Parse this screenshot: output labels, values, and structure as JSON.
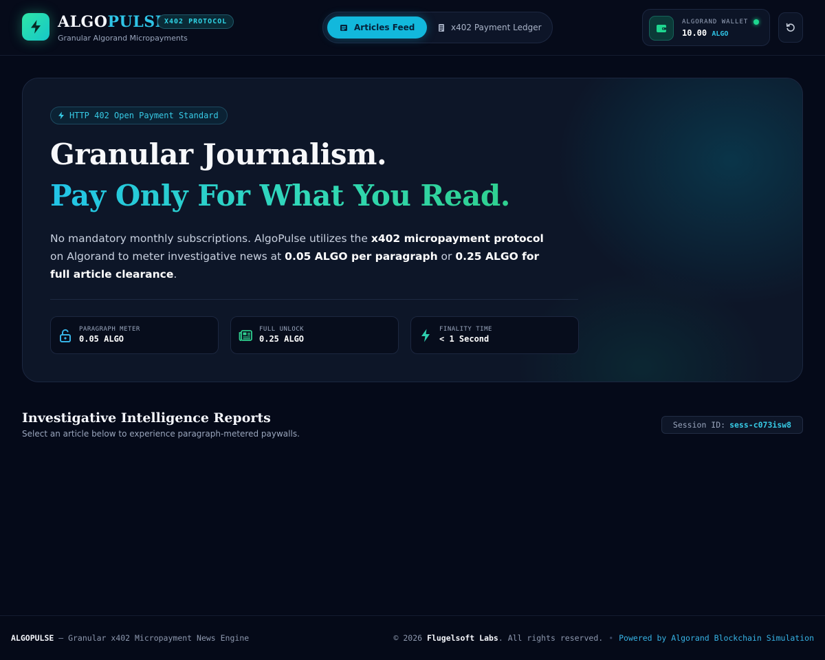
{
  "brand": {
    "name_part1": "ALGO",
    "name_part2": "PULSE",
    "protocol_badge": "X402 PROTOCOL",
    "tagline": "Granular Algorand Micropayments",
    "logo_icon": "lightning-bolt-icon"
  },
  "nav": {
    "tabs": [
      {
        "label": "Articles Feed",
        "icon": "newspaper-icon",
        "active": true
      },
      {
        "label": "x402 Payment Ledger",
        "icon": "receipt-icon",
        "active": false
      }
    ]
  },
  "wallet": {
    "label": "ALGORAND WALLET",
    "amount": "10.00",
    "unit": "ALGO",
    "status": "connected",
    "icon": "wallet-icon"
  },
  "reset": {
    "icon": "reset-icon"
  },
  "hero": {
    "badge": "HTTP 402 Open Payment Standard",
    "title_line1": "Granular Journalism.",
    "title_line2": "Pay Only For What You Read.",
    "desc_1": "No mandatory monthly subscriptions. AlgoPulse utilizes the ",
    "desc_b1": "x402 micropayment protocol",
    "desc_2": " on Algorand to meter investigative news at ",
    "desc_b2": "0.05 ALGO per paragraph",
    "desc_3": " or ",
    "desc_b3": "0.25 ALGO for full article clearance",
    "desc_4": ".",
    "stats": [
      {
        "label": "PARAGRAPH METER",
        "value": "0.05 ALGO",
        "icon": "unlock-icon"
      },
      {
        "label": "FULL UNLOCK",
        "value": "0.25 ALGO",
        "icon": "newspaper-icon"
      },
      {
        "label": "FINALITY TIME",
        "value": "< 1 Second",
        "icon": "lightning-bolt-icon"
      }
    ]
  },
  "reports": {
    "title": "Investigative Intelligence Reports",
    "subtitle": "Select an article below to experience paragraph-metered paywalls.",
    "session_label": "Session ID:",
    "session_id": "sess-c073isw8"
  },
  "footer": {
    "brand": "ALGOPULSE",
    "tagline": " — Granular x402 Micropayment News Engine",
    "copyright_prefix": "© 2026 ",
    "company": "Flugelsoft Labs",
    "copyright_suffix": ". All rights reserved.",
    "separator": "•",
    "powered": "Powered by Algorand Blockchain Simulation"
  },
  "colors": {
    "background": "#050a19",
    "accent_cyan": "#12b8dc",
    "accent_green": "#2ee6a6",
    "status_green": "#1ed68f"
  }
}
